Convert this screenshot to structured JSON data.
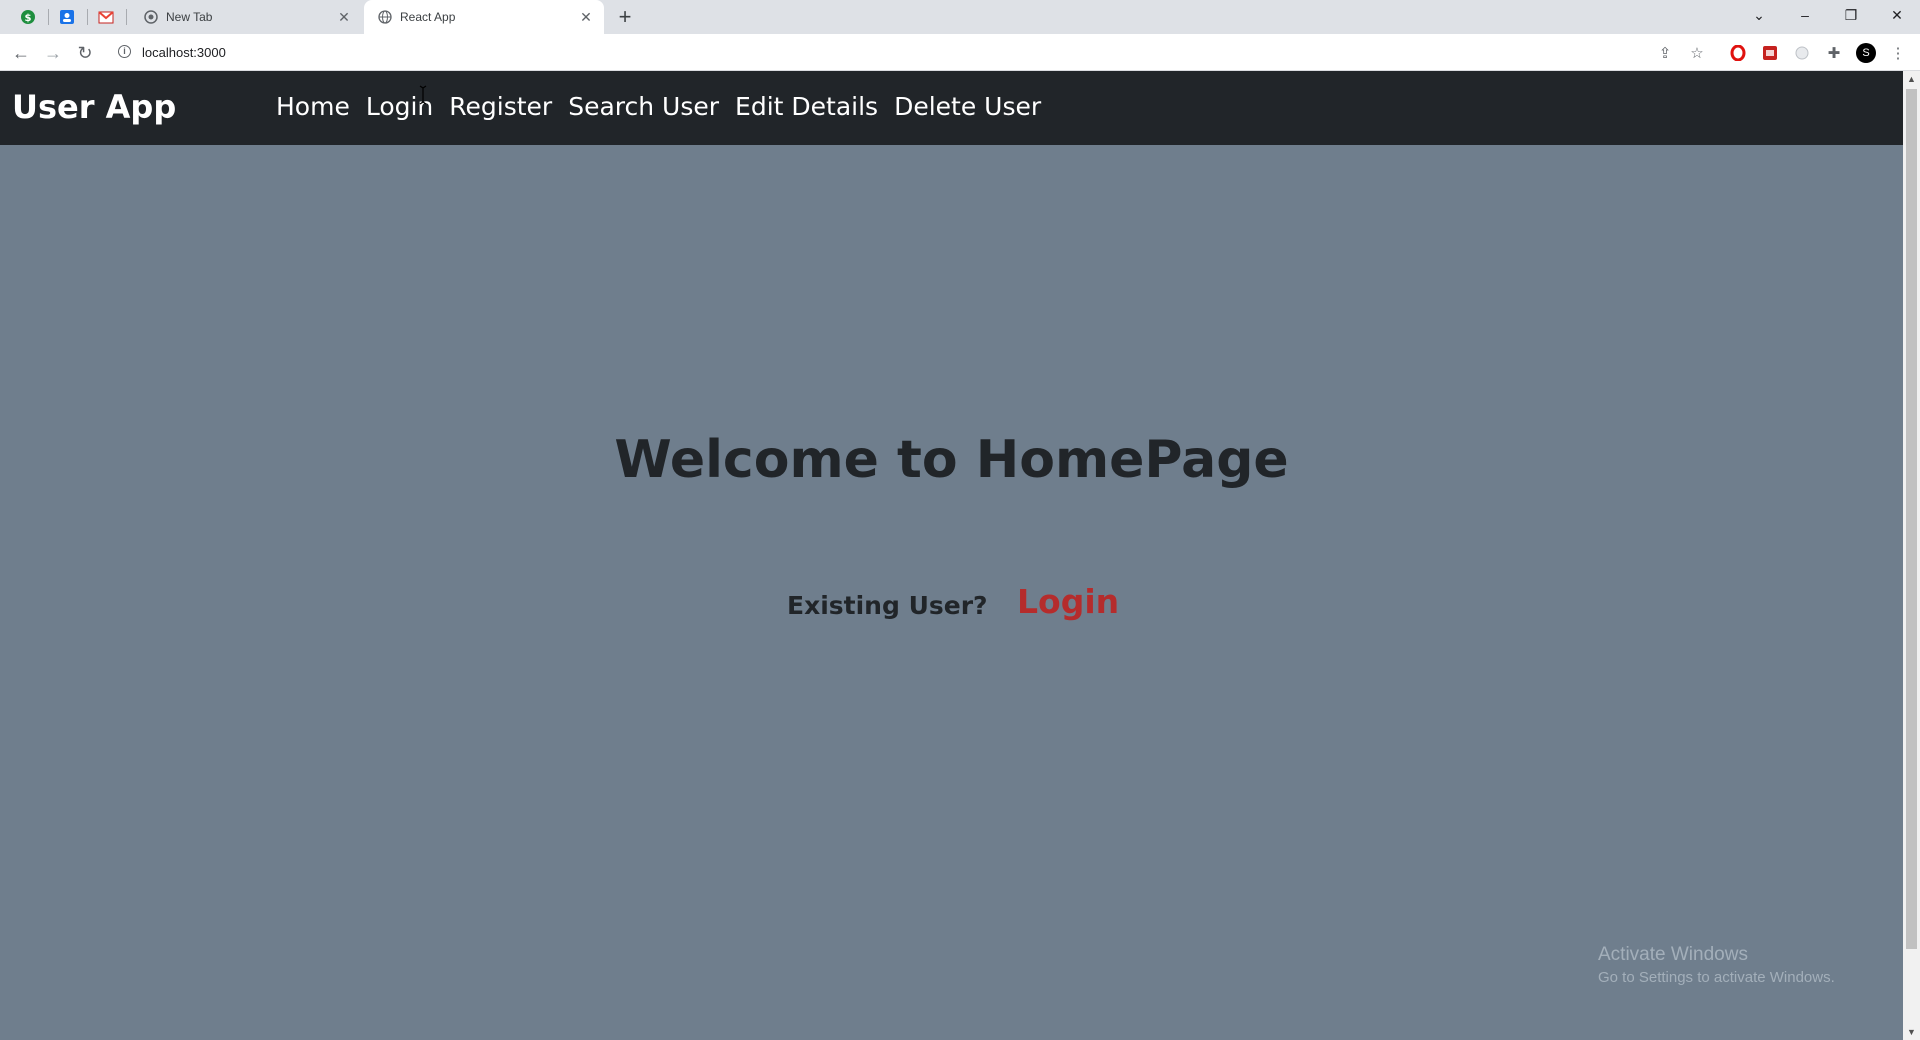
{
  "browser": {
    "pinned_tabs": [
      {
        "icon": "green-dollar-icon",
        "color": "#1e8e3e"
      },
      {
        "icon": "blue-contacts-icon",
        "color": "#1a73e8"
      },
      {
        "icon": "gmail-icon",
        "color": "#ea4335"
      }
    ],
    "tabs": [
      {
        "title": "New Tab",
        "active": false
      },
      {
        "title": "React App",
        "active": true
      }
    ],
    "address": "localhost:3000",
    "profile_initial": "S"
  },
  "app": {
    "brand": "User App",
    "nav": [
      "Home",
      "Login",
      "Register",
      "Search User",
      "Edit Details",
      "Delete User"
    ],
    "welcome": "Welcome to HomePage",
    "existing_user": "Existing User?",
    "login_link": "Login",
    "colors": {
      "navbar": "#212529",
      "background": "#6f7e8d",
      "login_link": "#b52c2c"
    }
  },
  "os": {
    "watermark_title": "Activate Windows",
    "watermark_sub": "Go to Settings to activate Windows."
  }
}
